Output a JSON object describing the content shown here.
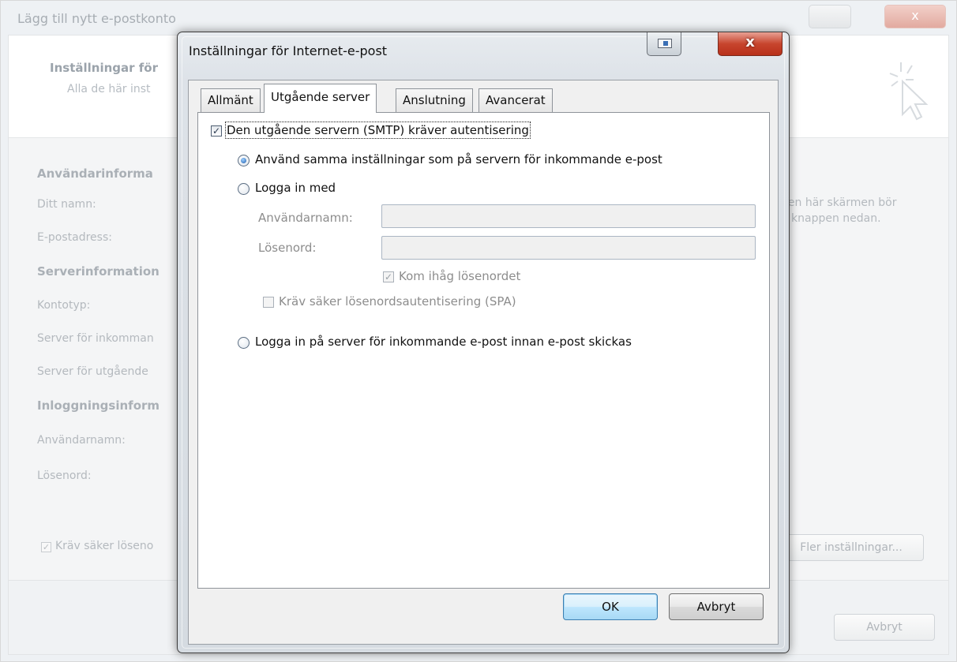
{
  "background_window": {
    "title": "Lägg till nytt e-postkonto",
    "header_title": "Inställningar för",
    "header_sub": "Alla de här inst",
    "labels": {
      "user_info": "Användarinforma",
      "your_name": "Ditt namn:",
      "email": "E-postadress:",
      "server_info": "Serverinformation",
      "account_type": "Kontotyp:",
      "incoming_server": "Server för inkomman",
      "outgoing_server": "Server för utgående",
      "login_info": "Inloggningsinform",
      "username": "Användarnamn:",
      "password": "Lösenord:"
    },
    "right_text_1": "den här skärmen bör",
    "right_text_2": "å knappen nedan.",
    "spa_check_label": "Kräv säker löseno",
    "more_settings_button": "Fler inställningar...",
    "cancel_button": "Avbryt"
  },
  "dialog": {
    "title": "Inställningar för Internet-e-post",
    "close_glyph": "x",
    "tabs": [
      {
        "label": "Allmänt"
      },
      {
        "label": "Utgående server"
      },
      {
        "label": "Anslutning"
      },
      {
        "label": "Avancerat"
      }
    ],
    "active_tab": "Utgående server",
    "smtp_auth_label": "Den utgående servern (SMTP) kräver autentisering",
    "smtp_auth_checked": true,
    "same_settings_label": "Använd samma inställningar som på servern för inkommande e-post",
    "login_with_label": "Logga in med",
    "username_label": "Användarnamn:",
    "password_label": "Lösenord:",
    "remember_password_label": "Kom ihåg lösenordet",
    "require_spa_label": "Kräv säker lösenordsautentisering (SPA)",
    "login_before_send_label": "Logga in på server för inkommande e-post innan e-post skickas",
    "ok_button": "OK",
    "cancel_button": "Avbryt",
    "check_glyph": "✓"
  }
}
